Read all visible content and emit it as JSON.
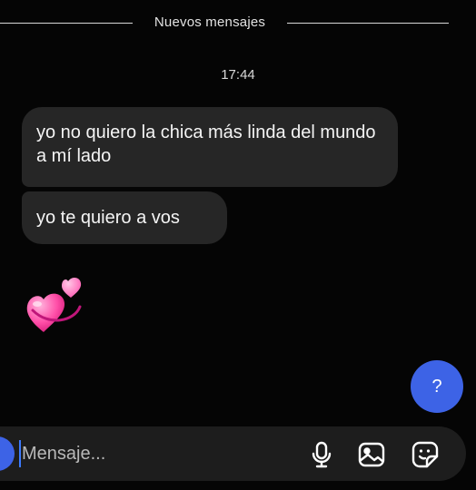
{
  "divider": {
    "label": "Nuevos mensajes"
  },
  "timestamp": "17:44",
  "messages": [
    {
      "text": "yo no quiero la chica más linda del mundo a mí lado"
    },
    {
      "text": "yo te quiero a vos"
    }
  ],
  "reaction_emoji": "two-hearts-emoji",
  "help_button": {
    "label": "?"
  },
  "composer": {
    "placeholder": "Mensaje...",
    "value": "",
    "icons": [
      "microphone-icon",
      "image-gallery-icon",
      "sticker-icon"
    ]
  },
  "colors": {
    "background": "#050505",
    "bubble": "#262626",
    "accent": "#3d63e6",
    "composer": "#1d1d1d"
  }
}
